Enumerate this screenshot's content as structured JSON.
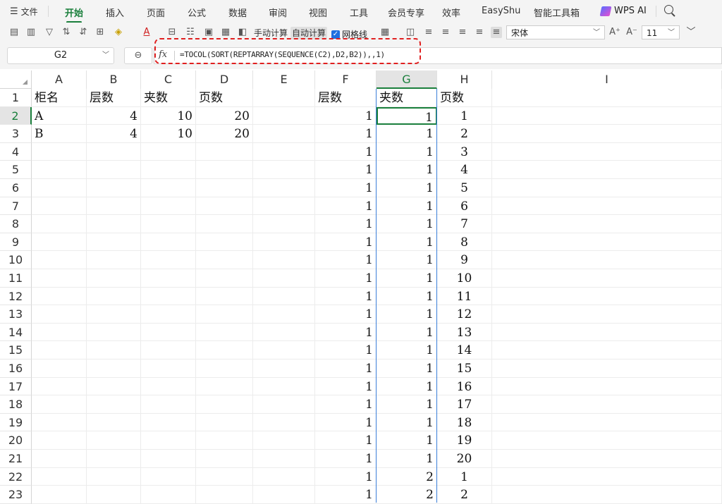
{
  "menubar": {
    "file_label": "文件",
    "tabs": [
      "开始",
      "插入",
      "页面",
      "公式",
      "数据",
      "审阅",
      "视图",
      "工具",
      "会员专享",
      "效率",
      "EasyShu",
      "智能工具箱"
    ],
    "active_tab": "开始",
    "ai_label": "WPS AI"
  },
  "toolbar": {
    "manual_calc": "手动计算",
    "auto_calc": "自动计算",
    "gridlines_label": "网格线",
    "gridlines_checked": true,
    "font_name": "宋体",
    "font_size": "11"
  },
  "formula_bar": {
    "name_box": "G2",
    "fx_label": "fx",
    "formula": "=TOCOL(SORT(REPTARRAY(SEQUENCE(C2),D2,B2)),,1)"
  },
  "sheet": {
    "columns": [
      "A",
      "B",
      "C",
      "D",
      "E",
      "F",
      "G",
      "H",
      "I"
    ],
    "selected_column": "G",
    "selected_row": "2",
    "rows": [
      {
        "n": "1",
        "A": "柜名",
        "B": "层数",
        "C": "夹数",
        "D": "页数",
        "E": "",
        "F": "层数",
        "G": "夹数",
        "H": "页数"
      },
      {
        "n": "2",
        "A": "A",
        "B": "4",
        "C": "10",
        "D": "20",
        "E": "",
        "F": "1",
        "G": "1",
        "H": "1"
      },
      {
        "n": "3",
        "A": "B",
        "B": "4",
        "C": "10",
        "D": "20",
        "E": "",
        "F": "1",
        "G": "1",
        "H": "2"
      },
      {
        "n": "4",
        "A": "",
        "B": "",
        "C": "",
        "D": "",
        "E": "",
        "F": "1",
        "G": "1",
        "H": "3"
      },
      {
        "n": "5",
        "A": "",
        "B": "",
        "C": "",
        "D": "",
        "E": "",
        "F": "1",
        "G": "1",
        "H": "4"
      },
      {
        "n": "6",
        "A": "",
        "B": "",
        "C": "",
        "D": "",
        "E": "",
        "F": "1",
        "G": "1",
        "H": "5"
      },
      {
        "n": "7",
        "A": "",
        "B": "",
        "C": "",
        "D": "",
        "E": "",
        "F": "1",
        "G": "1",
        "H": "6"
      },
      {
        "n": "8",
        "A": "",
        "B": "",
        "C": "",
        "D": "",
        "E": "",
        "F": "1",
        "G": "1",
        "H": "7"
      },
      {
        "n": "9",
        "A": "",
        "B": "",
        "C": "",
        "D": "",
        "E": "",
        "F": "1",
        "G": "1",
        "H": "8"
      },
      {
        "n": "10",
        "A": "",
        "B": "",
        "C": "",
        "D": "",
        "E": "",
        "F": "1",
        "G": "1",
        "H": "9"
      },
      {
        "n": "11",
        "A": "",
        "B": "",
        "C": "",
        "D": "",
        "E": "",
        "F": "1",
        "G": "1",
        "H": "10"
      },
      {
        "n": "12",
        "A": "",
        "B": "",
        "C": "",
        "D": "",
        "E": "",
        "F": "1",
        "G": "1",
        "H": "11"
      },
      {
        "n": "13",
        "A": "",
        "B": "",
        "C": "",
        "D": "",
        "E": "",
        "F": "1",
        "G": "1",
        "H": "12"
      },
      {
        "n": "14",
        "A": "",
        "B": "",
        "C": "",
        "D": "",
        "E": "",
        "F": "1",
        "G": "1",
        "H": "13"
      },
      {
        "n": "15",
        "A": "",
        "B": "",
        "C": "",
        "D": "",
        "E": "",
        "F": "1",
        "G": "1",
        "H": "14"
      },
      {
        "n": "16",
        "A": "",
        "B": "",
        "C": "",
        "D": "",
        "E": "",
        "F": "1",
        "G": "1",
        "H": "15"
      },
      {
        "n": "17",
        "A": "",
        "B": "",
        "C": "",
        "D": "",
        "E": "",
        "F": "1",
        "G": "1",
        "H": "16"
      },
      {
        "n": "18",
        "A": "",
        "B": "",
        "C": "",
        "D": "",
        "E": "",
        "F": "1",
        "G": "1",
        "H": "17"
      },
      {
        "n": "19",
        "A": "",
        "B": "",
        "C": "",
        "D": "",
        "E": "",
        "F": "1",
        "G": "1",
        "H": "18"
      },
      {
        "n": "20",
        "A": "",
        "B": "",
        "C": "",
        "D": "",
        "E": "",
        "F": "1",
        "G": "1",
        "H": "19"
      },
      {
        "n": "21",
        "A": "",
        "B": "",
        "C": "",
        "D": "",
        "E": "",
        "F": "1",
        "G": "1",
        "H": "20"
      },
      {
        "n": "22",
        "A": "",
        "B": "",
        "C": "",
        "D": "",
        "E": "",
        "F": "1",
        "G": "2",
        "H": "1"
      },
      {
        "n": "23",
        "A": "",
        "B": "",
        "C": "",
        "D": "",
        "E": "",
        "F": "1",
        "G": "2",
        "H": "2"
      }
    ]
  },
  "colors": {
    "accent_green": "#1a7f3c",
    "highlight_red": "#e02020",
    "selection_blue": "#3b7fd9"
  }
}
